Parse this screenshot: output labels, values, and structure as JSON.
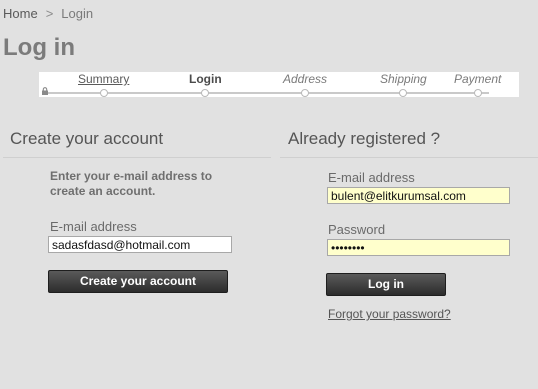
{
  "breadcrumb": {
    "home": "Home",
    "separator": ">",
    "current": "Login"
  },
  "page_title": "Log in",
  "steps": [
    {
      "label": "Summary"
    },
    {
      "label": "Login"
    },
    {
      "label": "Address"
    },
    {
      "label": "Shipping"
    },
    {
      "label": "Payment"
    }
  ],
  "create_account": {
    "title": "Create your account",
    "intro": "Enter your e-mail address to create an account.",
    "email_label": "E-mail address",
    "email_value": "sadasfdasd@hotmail.com",
    "button_label": "Create your account"
  },
  "login": {
    "title": "Already registered ?",
    "email_label": "E-mail address",
    "email_value": "bulent@elitkurumsal.com",
    "password_label": "Password",
    "password_value": "••••••••",
    "button_label": "Log in",
    "forgot_label": "Forgot your password?"
  },
  "colors": {
    "background": "#e1e1e1",
    "button": "#2c2c2c",
    "autofill": "#ffffcc"
  }
}
